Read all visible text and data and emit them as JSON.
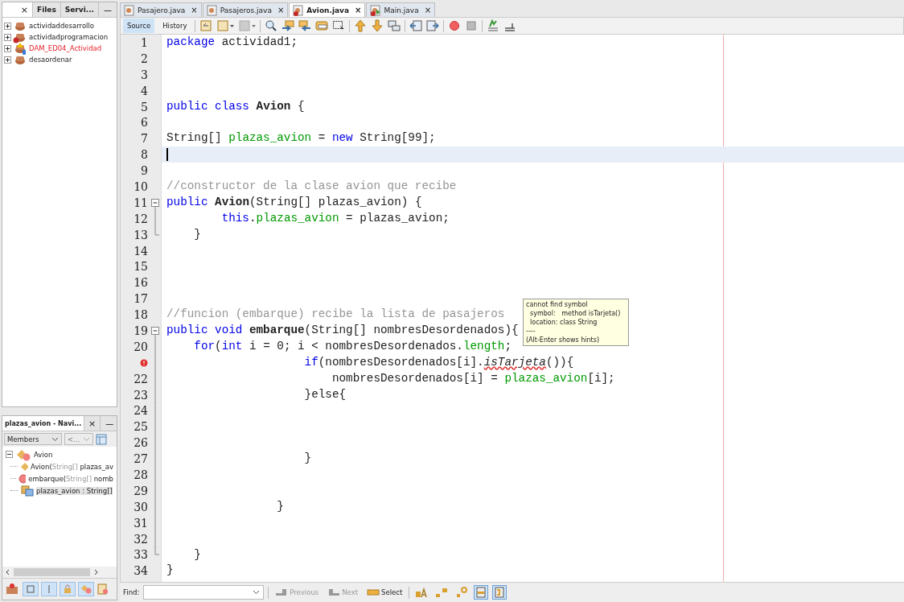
{
  "projects_panel": {
    "tabs": [
      {
        "close": "×",
        "selected": true
      },
      {
        "label": "Files",
        "selected": false
      },
      {
        "label": "Servi...",
        "selected": false
      }
    ],
    "minimize": "—",
    "tree": [
      {
        "label": "actividaddesarrollo",
        "kind": "normal"
      },
      {
        "label": "actividadprogramacion",
        "kind": "error"
      },
      {
        "label": "DAM_ED04_Actividad",
        "kind": "broken"
      },
      {
        "label": "desaordenar",
        "kind": "normal"
      }
    ]
  },
  "navigator": {
    "title": "plazas_avion - Navi...",
    "close": "×",
    "minimize": "—",
    "filter": "Members",
    "second_filter": {
      "label": "<...",
      "disabled": true
    },
    "root": {
      "label": "Avion",
      "expanded": true,
      "children": [
        {
          "kind": "constructor",
          "name": "Avion(",
          "type": "String[]",
          "rest": " plazas_av",
          "selected": false
        },
        {
          "kind": "method",
          "name": "embarque(",
          "type": "String[]",
          "rest": " nomb",
          "selected": false
        },
        {
          "kind": "field",
          "name": "plazas_avion : String[]",
          "selected": true
        }
      ]
    }
  },
  "editor_tabs": [
    {
      "label": "Pasajero.java",
      "kind": "class",
      "selected": false,
      "close": "×"
    },
    {
      "label": "Pasajeros.java",
      "kind": "class",
      "selected": false,
      "close": "×"
    },
    {
      "label": "Avion.java",
      "kind": "class-error",
      "selected": true,
      "close": "×"
    },
    {
      "label": "Main.java",
      "kind": "main-error",
      "selected": false,
      "close": "×"
    }
  ],
  "view_tabs": [
    {
      "label": "Source",
      "selected": true
    },
    {
      "label": "History",
      "selected": false
    }
  ],
  "code": [
    {
      "number": "1",
      "tokens": [
        {
          "kind": "keyword",
          "text": "package"
        },
        {
          "kind": "plain",
          "text": " actividad1;"
        }
      ]
    },
    {
      "number": "2"
    },
    {
      "number": "3"
    },
    {
      "number": "4"
    },
    {
      "number": "5",
      "tokens": [
        {
          "kind": "keyword",
          "text": "public class"
        },
        {
          "kind": "bold",
          "text": " Avion"
        },
        {
          "kind": "plain",
          "text": " {"
        }
      ]
    },
    {
      "number": "6"
    },
    {
      "number": "7",
      "tokens": [
        {
          "kind": "plain",
          "text": "String[] "
        },
        {
          "kind": "field",
          "text": "plazas_avion"
        },
        {
          "kind": "plain",
          "text": " = "
        },
        {
          "kind": "keyword",
          "text": "new"
        },
        {
          "kind": "plain",
          "text": " String[99];"
        }
      ]
    },
    {
      "number": "8",
      "current": true
    },
    {
      "number": "9"
    },
    {
      "number": "10",
      "tokens": [
        {
          "kind": "comment",
          "text": "//constructor de la clase avion que recibe"
        }
      ]
    },
    {
      "number": "11",
      "fold_start": true,
      "tokens": [
        {
          "kind": "keyword",
          "text": "public"
        },
        {
          "kind": "bold",
          "text": " Avion"
        },
        {
          "kind": "plain",
          "text": "(String[] plazas_avion) {"
        }
      ]
    },
    {
      "number": "12",
      "fold_body": true,
      "tokens": [
        {
          "kind": "keyword",
          "text": "        this"
        },
        {
          "kind": "plain",
          "text": "."
        },
        {
          "kind": "field",
          "text": "plazas_avion"
        },
        {
          "kind": "plain",
          "text": " = plazas_avion;"
        }
      ]
    },
    {
      "number": "13",
      "fold_end": true,
      "tokens": [
        {
          "kind": "plain",
          "text": "    }"
        }
      ]
    },
    {
      "number": "14"
    },
    {
      "number": "15"
    },
    {
      "number": "16"
    },
    {
      "number": "17"
    },
    {
      "number": "18",
      "tokens": [
        {
          "kind": "comment",
          "text": "//funcion (embarque) recibe la lista de pasajeros"
        }
      ]
    },
    {
      "number": "19",
      "fold_start": true,
      "tokens": [
        {
          "kind": "keyword",
          "text": "public void"
        },
        {
          "kind": "bold",
          "text": " embarque"
        },
        {
          "kind": "plain",
          "text": "(String[] nombresDesordenados){"
        }
      ]
    },
    {
      "number": "20",
      "fold_body": true,
      "tokens": [
        {
          "kind": "keyword",
          "text": "    for"
        },
        {
          "kind": "plain",
          "text": "("
        },
        {
          "kind": "keyword",
          "text": "int"
        },
        {
          "kind": "plain",
          "text": " i = 0; i < nombresDesordenados."
        },
        {
          "kind": "field",
          "text": "length"
        },
        {
          "kind": "plain",
          "text": ";"
        }
      ]
    },
    {
      "error": true,
      "fold_body": true,
      "tokens": [
        {
          "kind": "keyword",
          "text": "                    if"
        },
        {
          "kind": "plain",
          "text": "(nombresDesordenados[i]."
        },
        {
          "kind": "error",
          "text": "isTarjeta"
        },
        {
          "kind": "plain",
          "text": "()){"
        }
      ]
    },
    {
      "number": "22",
      "fold_body": true,
      "tokens": [
        {
          "kind": "plain",
          "text": "                        nombresDesordenados[i] = "
        },
        {
          "kind": "field",
          "text": "plazas_avion"
        },
        {
          "kind": "plain",
          "text": "[i];"
        }
      ]
    },
    {
      "number": "23",
      "fold_body": true,
      "tokens": [
        {
          "kind": "plain",
          "text": "                    }else{"
        }
      ]
    },
    {
      "number": "24",
      "fold_body": true
    },
    {
      "number": "25",
      "fold_body": true
    },
    {
      "number": "26",
      "fold_body": true
    },
    {
      "number": "27",
      "fold_body": true,
      "tokens": [
        {
          "kind": "plain",
          "text": "                    }"
        }
      ]
    },
    {
      "number": "28",
      "fold_body": true
    },
    {
      "number": "29",
      "fold_body": true
    },
    {
      "number": "30",
      "fold_body": true,
      "tokens": [
        {
          "kind": "plain",
          "text": "                }"
        }
      ]
    },
    {
      "number": "31",
      "fold_body": true
    },
    {
      "number": "32",
      "fold_body": true
    },
    {
      "number": "33",
      "fold_end": true,
      "tokens": [
        {
          "kind": "plain",
          "text": "    }"
        }
      ]
    },
    {
      "number": "34",
      "tokens": [
        {
          "kind": "plain",
          "text": "}"
        }
      ]
    }
  ],
  "tooltip": [
    "cannot find symbol",
    "  symbol:   method isTarjeta()",
    "  location: class String",
    "----",
    "(Alt-Enter shows hints)"
  ],
  "find_bar": {
    "label": "Find:",
    "buttons": [
      {
        "label": "Previous",
        "disabled": true
      },
      {
        "label": "Next",
        "disabled": true
      },
      {
        "label": "Select",
        "disabled": false
      }
    ],
    "toggles": [
      {
        "kind": "match-case",
        "selected": false
      },
      {
        "kind": "prev-match",
        "selected": false
      },
      {
        "kind": "next-match",
        "selected": false
      },
      {
        "kind": "highlight",
        "selected": true
      },
      {
        "kind": "wrap",
        "selected": true
      }
    ]
  }
}
